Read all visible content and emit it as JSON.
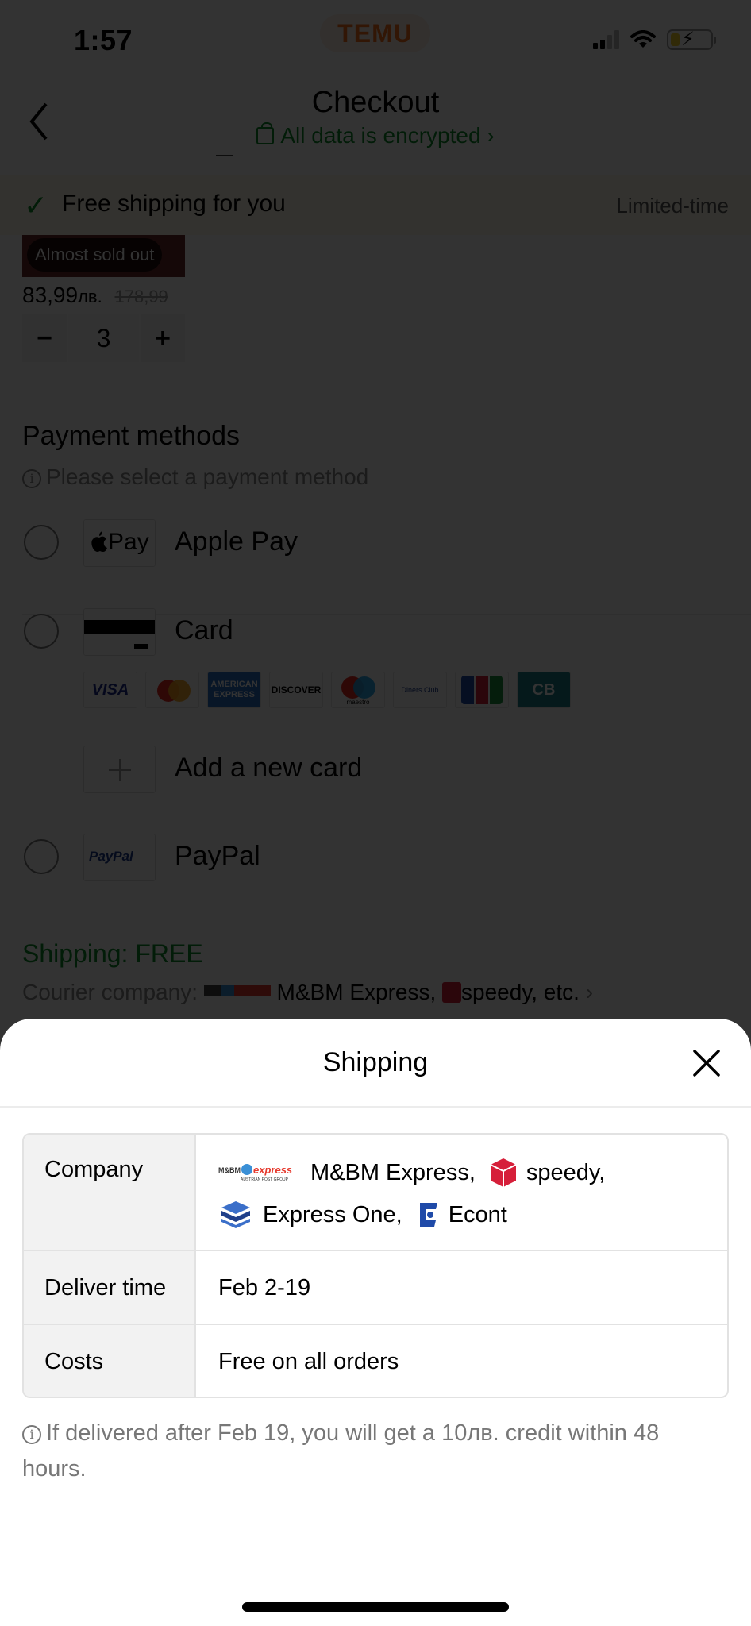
{
  "status_bar": {
    "time": "1:57",
    "carrier_badge": "TEMU",
    "icons": [
      "cellular-signal-icon",
      "wifi-icon",
      "battery-charging-icon"
    ]
  },
  "nav": {
    "back_icon": "chevron-left-icon",
    "title": "Checkout",
    "secure_label": "All data is encrypted",
    "secure_chevron": "›"
  },
  "banner": {
    "check_icon": "✓",
    "label": "Free shipping for you",
    "tag": "Limited-time"
  },
  "item": {
    "badge": "Almost sold out",
    "price": "83,99",
    "currency": "лв.",
    "original_price": "178,99",
    "quantity": "3",
    "minus": "−",
    "plus": "+"
  },
  "payment": {
    "title": "Payment methods",
    "note": "Please select a payment method",
    "methods": [
      {
        "label": "Apple Pay",
        "logo": "apple-pay-logo",
        "logo_text": "Pay"
      },
      {
        "label": "Card",
        "logo": "card-logo"
      },
      {
        "label": "Add a new card",
        "logo": "plus-icon"
      },
      {
        "label": "PayPal",
        "logo": "paypal-logo",
        "logo_text": "PayPal"
      }
    ],
    "card_brands": [
      "VISA",
      "Mastercard",
      "AMERICAN EXPRESS",
      "DISCOVER",
      "maestro",
      "Diners Club",
      "JCB",
      "CB"
    ]
  },
  "shipping_summary": {
    "title": "Shipping: FREE",
    "courier_prefix": "Courier company:",
    "courier_companies": "M&BM Express,",
    "courier_second": "speedy, etc.",
    "chevron": "›"
  },
  "sheet": {
    "title": "Shipping",
    "close_icon": "close-icon",
    "table": [
      {
        "key": "Company",
        "companies": [
          "M&BM Express,",
          "speedy,",
          "Express One,",
          "Econt"
        ]
      },
      {
        "key": "Deliver time",
        "value": "Feb 2-19"
      },
      {
        "key": "Costs",
        "value": "Free on all orders"
      }
    ],
    "note": "If delivered after Feb 19, you will get a 10лв. credit within 48 hours."
  },
  "colors": {
    "brand_orange": "#f76d1c",
    "success_green": "#0a8a2a",
    "speedy_red": "#d61f3a",
    "econt_blue": "#1f4aa8"
  }
}
